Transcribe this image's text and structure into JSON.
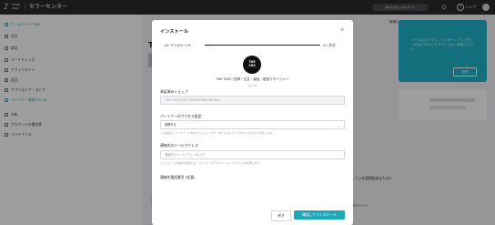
{
  "header": {
    "logo_lines": [
      "TikTok",
      "Shop"
    ],
    "title_sep": "|",
    "title": "セラーセンター",
    "pill_label": "あなたのビジネスサイト",
    "help_label": "ヘルプ"
  },
  "sidebar": {
    "items": [
      {
        "label": "ホームページ TBD",
        "icon": "home-icon"
      },
      {
        "label": "注文",
        "icon": "order-icon"
      },
      {
        "label": "商品",
        "icon": "product-icon"
      },
      {
        "label": "マーケティング",
        "icon": "marketing-icon"
      },
      {
        "label": "アフィリエイト",
        "icon": "affiliate-icon"
      },
      {
        "label": "返品",
        "icon": "return-icon"
      },
      {
        "label": "アプリストア・ストア",
        "icon": "app-store-icon"
      },
      {
        "label": "パートナー管理 (3) TB",
        "icon": "partner-icon"
      },
      {
        "label": "分析",
        "icon": "analytics-icon"
      },
      {
        "label": "アカウントの健全性",
        "icon": "health-icon"
      },
      {
        "label": "ファイナンス",
        "icon": "finance-icon"
      }
    ]
  },
  "main": {
    "title": "T"
  },
  "promo": {
    "head": "新着のアプリが追加できます",
    "text": "ツールにおアプリ、インポートアシスタントをはじめとしたサービスをご利用ください",
    "button": "詳細",
    "note1": "している国際配送またはE",
    "note2": "ありシリー"
  },
  "modal": {
    "title": "インストール",
    "close": "×",
    "step1": "01 インストール",
    "step2": "02 承認",
    "logo_lines": [
      "THE",
      "CHS"
    ],
    "app_name": "THE CHS | 在庫・注文・製品・配送マネージャー",
    "app_by": "by chs",
    "store_label": "承認済みショップ",
    "store_value": "THE CHS SHOP (TKSHOPPINGLIMITED)",
    "access_label": "パートナーのアクセス設定",
    "access_value": "制限付き",
    "access_help": "この設定は、パートナーがあなたのショップのデータにどのようにアクセスできるかを決定します。",
    "email_label": "連絡先のメールアドレス",
    "email_placeholder": "連絡先のメールアドレスを入力",
    "email_help": "パートナーへの連絡や通知には、パートナーのアカウントメールアドレスを使用します。",
    "phone_label": "連絡先電話番号 (任意)",
    "cancel": "戻す",
    "confirm": "確認してインストール"
  },
  "colors": {
    "accent": "#1ea7b9",
    "promo": "#1eb3c7",
    "topbar": "#2a2a2c"
  }
}
